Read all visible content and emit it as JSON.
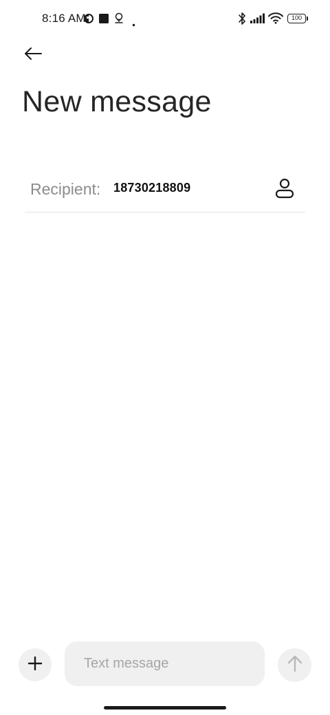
{
  "status_bar": {
    "time": "8:16 AM",
    "battery": "100",
    "icons": [
      "circle-half-icon",
      "square-icon",
      "location-pin-icon",
      "dot-icon",
      "bluetooth-icon",
      "signal-icon",
      "wifi-icon",
      "battery-icon"
    ]
  },
  "header": {
    "back_icon": "arrow-left-icon",
    "title": "New message"
  },
  "recipient": {
    "label": "Recipient:",
    "value": "18730218809",
    "contact_icon": "person-icon"
  },
  "compose": {
    "add_icon": "plus-icon",
    "placeholder": "Text message",
    "value": "",
    "send_icon": "arrow-up-icon"
  },
  "colors": {
    "background": "#ffffff",
    "input_background": "#f0f0f0",
    "label_gray": "#8c8c8c",
    "placeholder_gray": "#a6a6a6",
    "divider": "#e3e3e3",
    "send_icon_disabled": "#b8b8b8"
  }
}
